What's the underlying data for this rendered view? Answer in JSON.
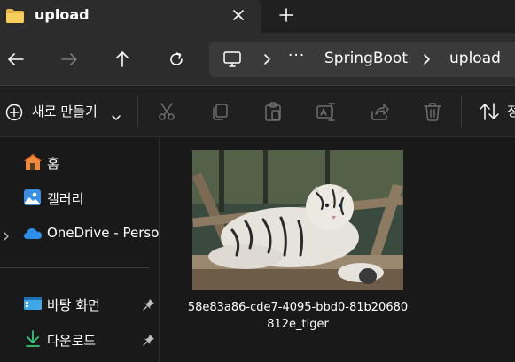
{
  "tab": {
    "title": "upload",
    "close_icon": "close-icon",
    "new_tab_icon": "plus-icon"
  },
  "nav": {
    "back_icon": "arrow-left-icon",
    "forward_icon": "arrow-right-icon",
    "up_icon": "arrow-up-icon",
    "refresh_icon": "refresh-icon"
  },
  "address": {
    "pc_icon": "monitor-icon",
    "overflow": "···",
    "crumbs": [
      "SpringBoot",
      "upload"
    ]
  },
  "toolbar": {
    "new_label": "새로 만들기",
    "sort_label": "정렬",
    "icons": [
      "cut-icon",
      "copy-icon",
      "paste-icon",
      "rename-icon",
      "share-icon",
      "delete-icon"
    ]
  },
  "sidebar": {
    "items": [
      {
        "label": "홈",
        "icon": "home-icon"
      },
      {
        "label": "갤러리",
        "icon": "gallery-icon"
      },
      {
        "label": "OneDrive - Personal",
        "icon": "cloud-icon"
      },
      {
        "label": "바탕 화면",
        "icon": "desktop-icon",
        "pinned": true
      },
      {
        "label": "다운로드",
        "icon": "download-icon",
        "pinned": true
      }
    ]
  },
  "files": [
    {
      "name": "58e83a86-cde7-4095-bbd0-81b20680812e_tiger",
      "type": "image"
    }
  ],
  "colors": {
    "accent": "#4cc2ff",
    "background": "#191919",
    "titlebar": "#202020",
    "toolbar_disabled": "#6e6e6e"
  }
}
